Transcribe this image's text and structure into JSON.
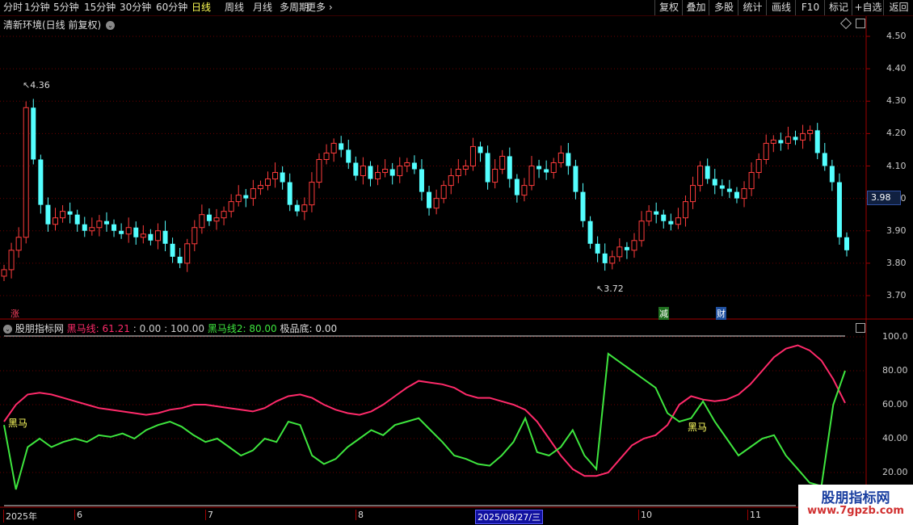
{
  "toolbar": {
    "periods": [
      "分时",
      "1分钟",
      "5分钟",
      "15分钟",
      "30分钟",
      "60分钟",
      "日线",
      "周线",
      "月线",
      "多周期",
      "更多"
    ],
    "active_period": "日线",
    "right_buttons": [
      "复权",
      "叠加",
      "多股",
      "统计",
      "画线",
      "F10",
      "标记",
      "+自选",
      "返回"
    ]
  },
  "main_chart": {
    "title": "清新环境(日线 前复权)",
    "price_ticks": [
      "4.50",
      "4.40",
      "4.30",
      "4.20",
      "4.10",
      "4.00",
      "3.90",
      "3.80",
      "3.70"
    ],
    "current_price": "3.98",
    "high_label": "4.36",
    "low_label": "3.72",
    "markers": [
      {
        "text": "涨",
        "color": "#ff4060"
      },
      {
        "text": "减",
        "color": "#40d040"
      },
      {
        "text": "财",
        "color": "#60a0ff"
      }
    ]
  },
  "indicator": {
    "name": "股朋指标网",
    "line1_label": "黑马线:",
    "line1_value": "61.21",
    "sep_values": ": 0.00 : 100.00",
    "line2_label": "黑马线2:",
    "line2_value": "80.00",
    "bottom_label": "极品底:",
    "bottom_value": "0.00",
    "ticks": [
      "100.0",
      "80.00",
      "60.00",
      "40.00",
      "20.00"
    ],
    "annotation": "黑马"
  },
  "date_axis": {
    "labels": [
      "2025年",
      "6",
      "7",
      "8",
      "2025/08/27/三",
      "10",
      "11"
    ]
  },
  "watermark": {
    "line1": "股朋指标网",
    "line2": "www.7gpzb.com"
  },
  "colors": {
    "up": "#ff3c3c",
    "down": "#54ffff",
    "pink_line": "#ff2a6a",
    "green_line": "#3ee63e",
    "grid": "#6a0000",
    "axis": "#a00000"
  }
}
